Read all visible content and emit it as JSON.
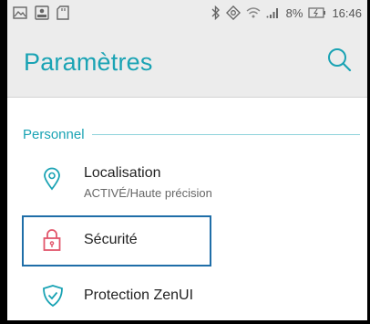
{
  "status_bar": {
    "battery": "8%",
    "time": "16:46",
    "left_icons": [
      "image-icon",
      "rec-icon",
      "sd-card-icon"
    ],
    "right_icons": [
      "bluetooth-icon",
      "sync-icon",
      "wifi-icon",
      "signal-icon",
      "battery-icon"
    ]
  },
  "header": {
    "title": "Paramètres",
    "search_icon": "search-icon"
  },
  "section": {
    "label": "Personnel"
  },
  "items": [
    {
      "title": "Localisation",
      "subtitle": "ACTIVÉ/Haute précision",
      "icon": "location-pin-icon"
    },
    {
      "title": "Sécurité",
      "icon": "lock-icon"
    },
    {
      "title": "Protection ZenUI",
      "icon": "shield-check-icon"
    }
  ],
  "colors": {
    "accent": "#1aa3b4",
    "lock": "#e2566b",
    "header_bg": "#ececec",
    "highlight_border": "#1f6ea8"
  }
}
